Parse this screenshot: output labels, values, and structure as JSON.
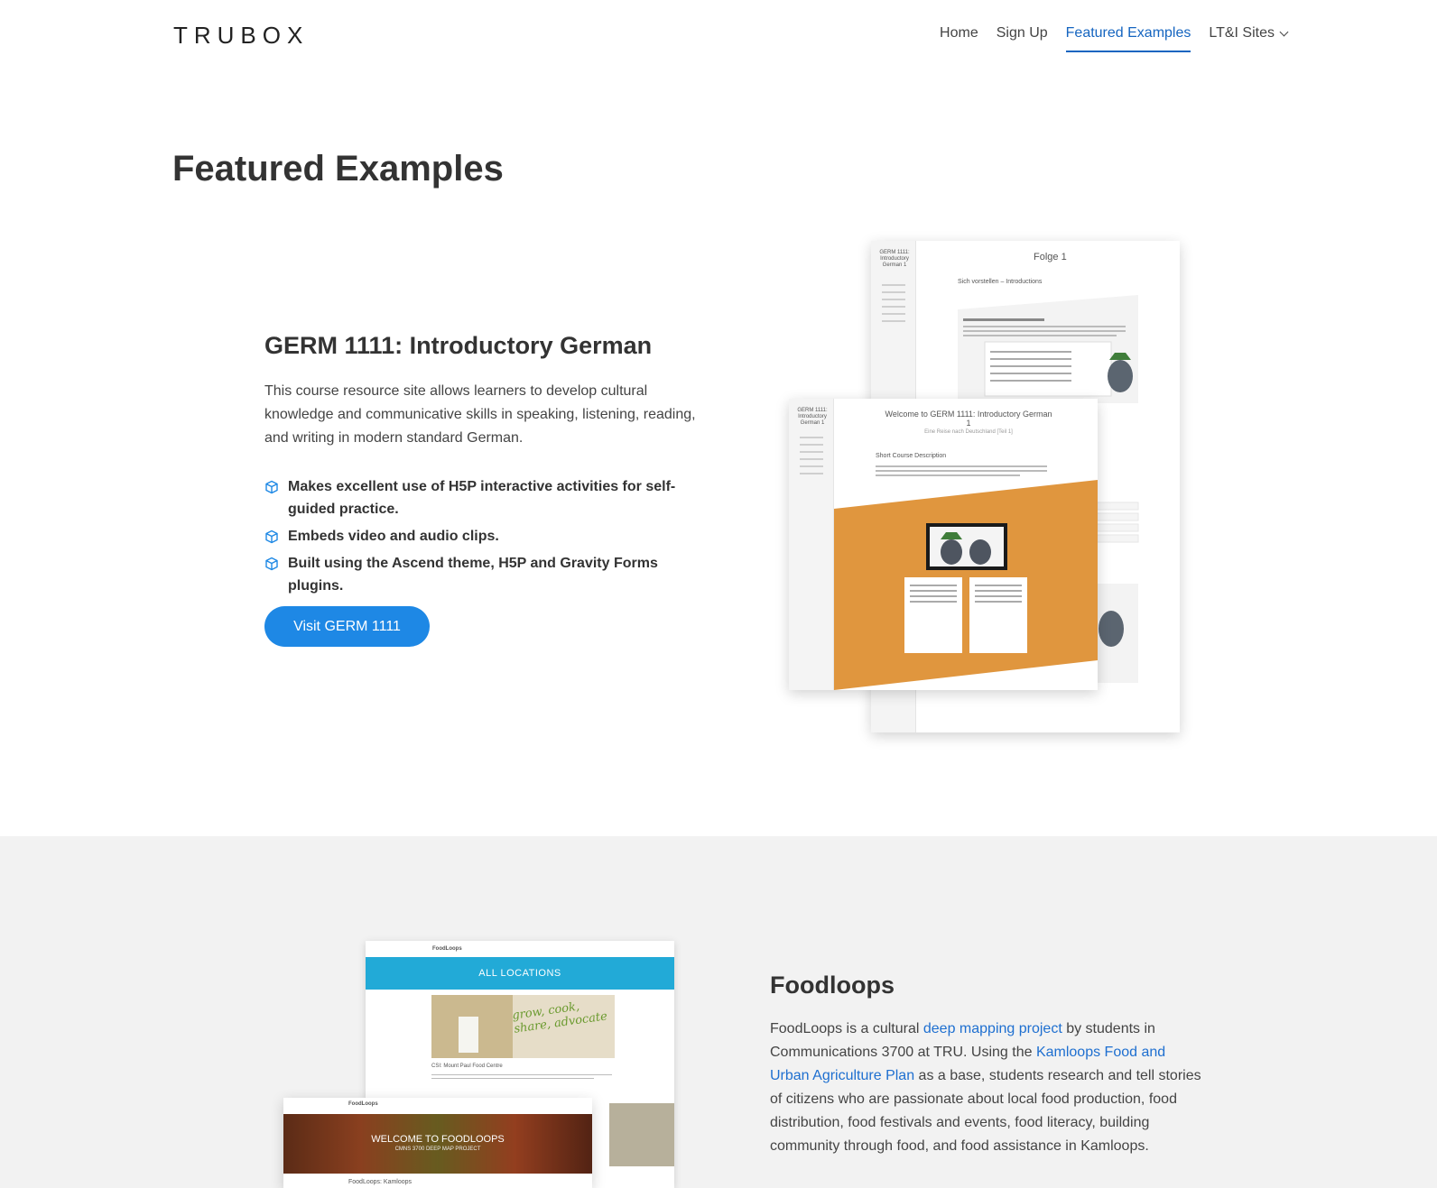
{
  "header": {
    "logo": "TRUBOX",
    "nav": [
      "Home",
      "Sign Up",
      "Featured Examples",
      "LT&I Sites"
    ]
  },
  "page": {
    "title": "Featured Examples"
  },
  "germ": {
    "title": "GERM 1111: Introductory German",
    "description": "This course resource site allows learners to develop cultural knowledge and communicative skills in speaking, listening, reading, and writing in modern standard German.",
    "features": [
      "Makes excellent use of H5P interactive activities for self-guided practice.",
      "Embeds video and audio clips.",
      "Built using the Ascend theme, H5P and Gravity Forms plugins."
    ],
    "button": "Visit GERM 1111",
    "mock_back_title": "Folge 1",
    "mock_back_subtitle": "Sich vorstellen – Introductions",
    "mock_back_side": "GERM 1111: Introductory German 1",
    "mock_front_title": "Welcome to GERM 1111: Introductory German 1",
    "mock_front_subtitle": "Eine Reise nach Deutschland [Teil 1]",
    "mock_front_section": "Short Course Description",
    "mock_front_side": "GERM 1111: Introductory German 1"
  },
  "foodloops": {
    "title": "Foodloops",
    "desc_1": "FoodLoops is a cultural ",
    "link_1": "deep mapping project",
    "desc_2": " by students in Communications 3700 at TRU. Using the ",
    "link_2": "Kamloops Food and Urban Agriculture Plan",
    "desc_3": " as a base, students research and tell stories of citizens who are passionate about local food production, food distribution, food festivals and events, food literacy, building community through food, and food assistance in Kamloops.",
    "mock_back_brand": "FoodLoops",
    "mock_back_banner": "ALL LOCATIONS",
    "mock_back_script": "grow, cook, share, advocate",
    "mock_back_item": "CSI: Mount Paul Food Centre",
    "mock_front_brand": "FoodLoops",
    "mock_front_hero": "WELCOME TO FOODLOOPS",
    "mock_front_hero_sub": "CMNS 3700 DEEP MAP PROJECT",
    "mock_front_heading": "FoodLoops: Kamloops"
  },
  "colors": {
    "accent": "#1565c0",
    "button": "#1e88e5",
    "orange": "#e0963e",
    "banner": "#22aad7",
    "band": "#f2f2f2"
  }
}
